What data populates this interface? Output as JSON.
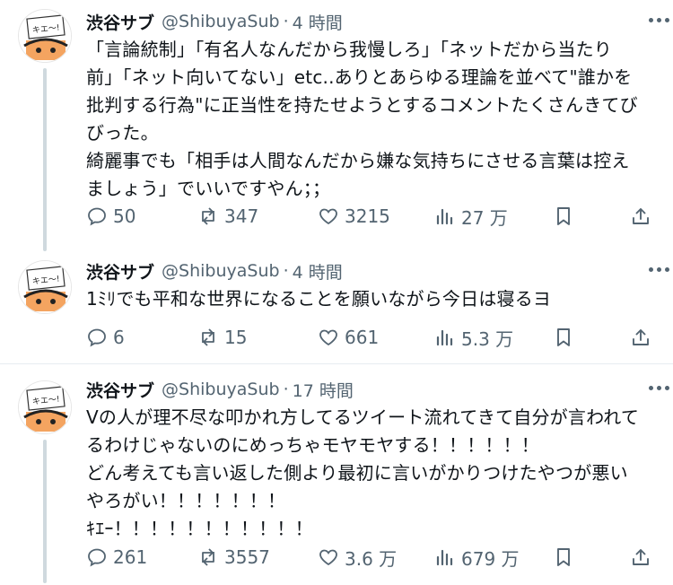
{
  "tweets": [
    {
      "name": "渋谷サブ",
      "handle": "@ShibuyaSub",
      "time": "4 時間",
      "avatar_text": "キエ〜!",
      "text": "「言論統制」「有名人なんだから我慢しろ」「ネットだから当たり\n前」「ネット向いてない」etc..ありとあらゆる理論を並べて\"誰かを\n批判する行為\"に正当性を持たせようとするコメントたくさんきてび\nびった。\n綺麗事でも「相手は人間なんだから嫌な気持ちにさせる言葉は控え\nましょう」でいいですやん；；",
      "replies": "50",
      "retweets": "347",
      "likes": "3215",
      "views": "27 万"
    },
    {
      "name": "渋谷サブ",
      "handle": "@ShibuyaSub",
      "time": "4 時間",
      "avatar_text": "キエ〜!",
      "text": "1ﾐﾘでも平和な世界になることを願いながら今日は寝るヨ",
      "replies": "6",
      "retweets": "15",
      "likes": "661",
      "views": "5.3 万"
    },
    {
      "name": "渋谷サブ",
      "handle": "@ShibuyaSub",
      "time": "17 時間",
      "avatar_text": "キエ〜!",
      "text": "Vの人が理不尽な叩かれ方してるツイート流れてきて自分が言われて\nるわけじゃないのにめっちゃモヤモヤする！！！！！！\nどん考えても言い返した側より最初に言いがかりつけたやつが悪い\nやろがい！！！！！！！\nｷｴｰ！！！！！！！！！！！",
      "replies": "261",
      "retweets": "3557",
      "likes": "3.6 万",
      "views": "679 万"
    }
  ],
  "colors": {
    "text": "#0f1419",
    "secondary": "#536471",
    "thread_line": "#cfd9de"
  }
}
